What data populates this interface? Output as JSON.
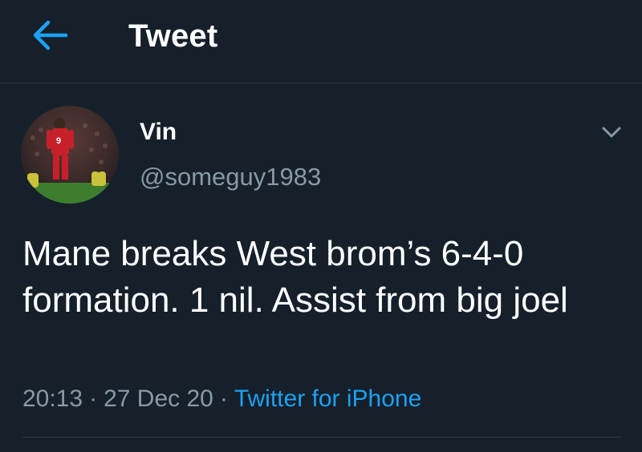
{
  "header": {
    "title": "Tweet",
    "back_icon": "arrow-left-icon"
  },
  "author": {
    "name": "Vin",
    "handle": "@someguy1983",
    "avatar_icon": "avatar-image"
  },
  "more_icon": "chevron-down-icon",
  "tweet": {
    "text": "Mane breaks West brom’s 6-4-0 formation. 1 nil. Assist from big joel",
    "time": "20:13",
    "separator": "·",
    "date": "27 Dec 20",
    "source": "Twitter for iPhone"
  },
  "colors": {
    "background": "#15202b",
    "accent": "#1da1f2",
    "secondary_text": "#8899a6",
    "border": "#2b3742"
  }
}
